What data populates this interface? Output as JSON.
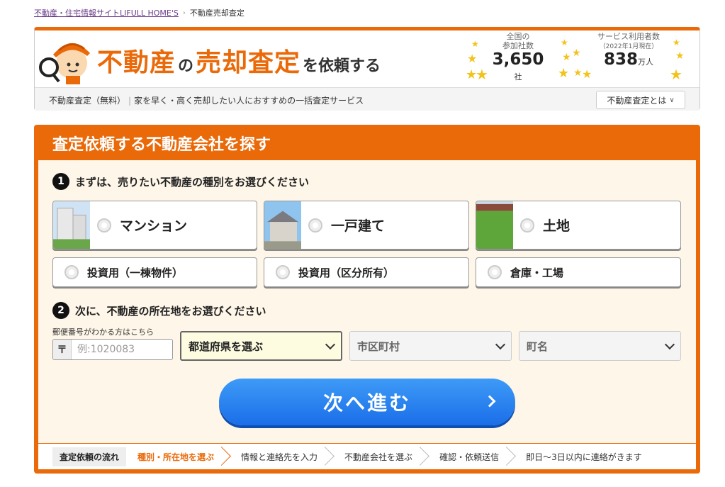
{
  "breadcrumb": {
    "items": [
      "不動産・住宅情報サイトLIFULL HOME'S",
      "不動産売却査定"
    ]
  },
  "header": {
    "title_part1": "不動産",
    "title_part2": "の",
    "title_part3": "売却査定",
    "title_part4": "を依頼する",
    "stat1": {
      "label1": "全国の",
      "label2": "参加社数",
      "value": "3,650",
      "unit": "社"
    },
    "stat2": {
      "label1": "サービス利用者数",
      "sub": "（2022年1月現在）",
      "value": "838",
      "unit": "万人"
    },
    "description_1": "不動産査定（無料）",
    "description_2": "家を早く・高く売却したい人におすすめの一括査定サービス",
    "about_button": "不動産査定とは"
  },
  "search": {
    "title": "査定依頼する不動産会社を探す",
    "step1": {
      "number": "1",
      "label": "まずは、売りたい不動産の種別をお選びください"
    },
    "property_types": [
      "マンション",
      "一戸建て",
      "土地"
    ],
    "property_types_small": [
      "投資用（一棟物件）",
      "投資用（区分所有）",
      "倉庫・工場"
    ],
    "step2": {
      "number": "2",
      "label": "次に、不動産の所在地をお選びください"
    },
    "zip": {
      "label": "郵便番号がわかる方はこちら",
      "mark": "〒",
      "placeholder": "例:1020083"
    },
    "prefecture": "都道府県を選ぶ",
    "city": "市区町村",
    "town": "町名",
    "next_button": "次へ進む"
  },
  "flow": {
    "head": "査定依頼の流れ",
    "steps": [
      "種別・所在地を選ぶ",
      "情報と連絡先を入力",
      "不動産会社を選ぶ",
      "確認・依頼送信",
      "即日～3日以内に連絡がきます"
    ]
  },
  "colors": {
    "accent": "#ea6a0a",
    "button": "#1a6ee8"
  }
}
